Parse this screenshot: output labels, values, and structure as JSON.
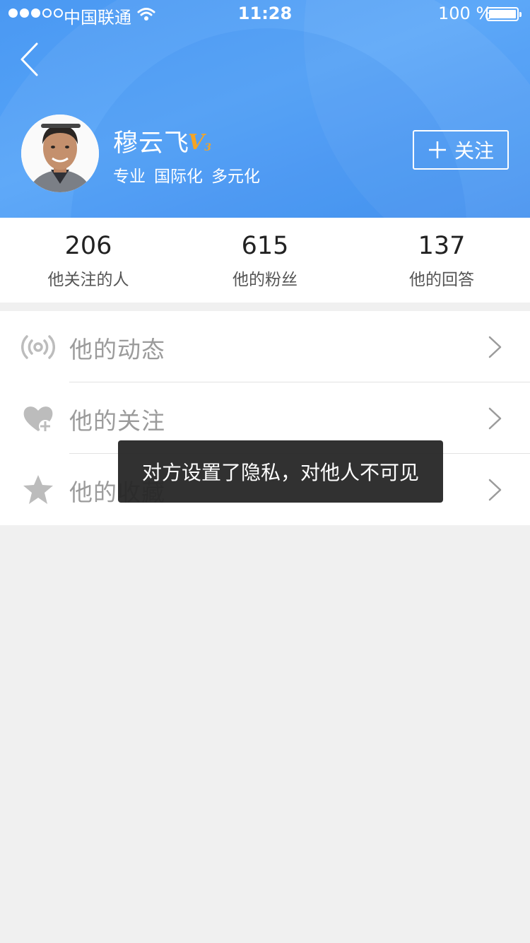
{
  "status_bar": {
    "carrier": "中国联通",
    "time": "11:28",
    "battery": "100 %"
  },
  "profile": {
    "name": "穆云飞",
    "verified_badge": "V",
    "verified_level": "3",
    "tags": [
      "专业",
      "国际化",
      "多元化"
    ],
    "follow_label": "关注"
  },
  "stats": [
    {
      "value": "206",
      "label": "他关注的人"
    },
    {
      "value": "615",
      "label": "他的粉丝"
    },
    {
      "value": "137",
      "label": "他的回答"
    }
  ],
  "menu": [
    {
      "label": "他的动态",
      "icon": "broadcast-icon"
    },
    {
      "label": "他的关注",
      "icon": "heart-plus-icon"
    },
    {
      "label": "他的收藏",
      "icon": "star-icon"
    }
  ],
  "toast": {
    "message": "对方设置了隐私，对他人不可见"
  },
  "colors": {
    "header_blue": "#4a98f2",
    "badge_orange": "#f4a425",
    "icon_gray": "#bcbcbc",
    "label_gray": "#9b9b9b",
    "background": "#f0f0f0"
  }
}
